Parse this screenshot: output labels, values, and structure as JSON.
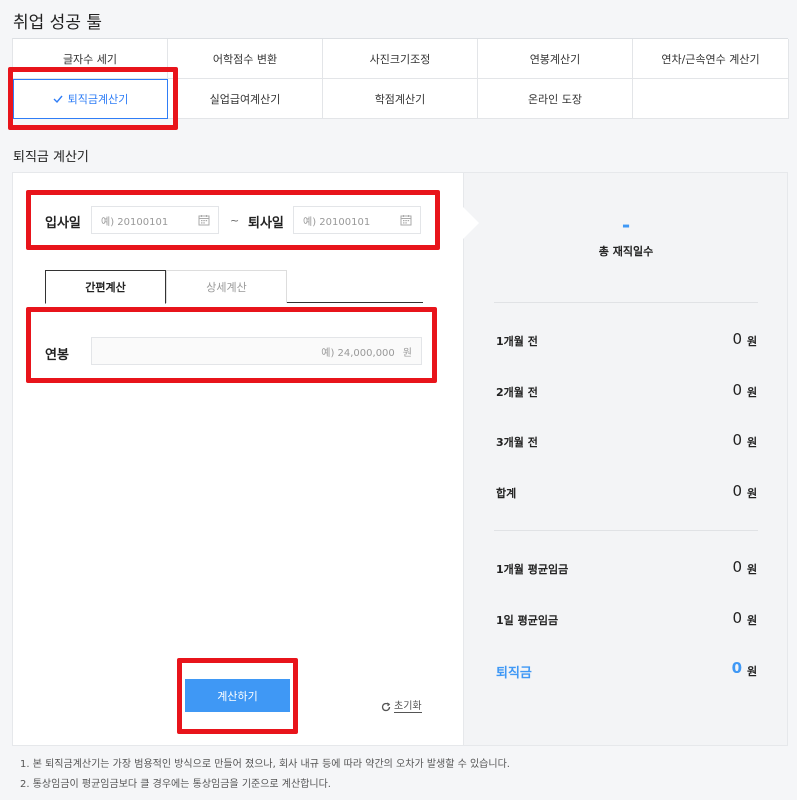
{
  "page_title": "취업 성공 툴",
  "tabs": [
    {
      "label": "글자수 세기"
    },
    {
      "label": "어학점수 변환"
    },
    {
      "label": "사진크기조정"
    },
    {
      "label": "연봉계산기"
    },
    {
      "label": "연차/근속연수 계산기"
    },
    {
      "label": "퇴직금계산기",
      "active": true
    },
    {
      "label": "실업급여계산기"
    },
    {
      "label": "학점계산기"
    },
    {
      "label": "온라인 도장"
    }
  ],
  "section_title": "퇴직금 계산기",
  "dates": {
    "start_label": "입사일",
    "start_placeholder": "예) 20100101",
    "separator": "~",
    "end_label": "퇴사일",
    "end_placeholder": "예) 20100101"
  },
  "subtabs": {
    "simple": "간편계산",
    "detail": "상세계산"
  },
  "salary": {
    "label": "연봉",
    "placeholder": "예) 24,000,000",
    "unit": "원"
  },
  "buttons": {
    "calculate": "계산하기",
    "reset": "초기화"
  },
  "result": {
    "days_value": "-",
    "days_label": "총 재직일수",
    "rows": [
      {
        "label": "1개월 전",
        "value": "0",
        "unit": "원"
      },
      {
        "label": "2개월 전",
        "value": "0",
        "unit": "원"
      },
      {
        "label": "3개월 전",
        "value": "0",
        "unit": "원"
      },
      {
        "label": "합계",
        "value": "0",
        "unit": "원"
      },
      {
        "label": "1개월 평균임금",
        "value": "0",
        "unit": "원"
      },
      {
        "label": "1일 평균임금",
        "value": "0",
        "unit": "원"
      },
      {
        "label": "퇴직금",
        "value": "0",
        "unit": "원"
      }
    ]
  },
  "notes": [
    "1. 본 퇴직금계산기는 가장 범용적인 방식으로 만들어 졌으나, 회사 내규 등에 따라 약간의 오차가 발생할 수 있습니다.",
    "2. 통상임금이 평균임금보다 클 경우에는 통상임금을 기준으로 계산합니다."
  ],
  "colors": {
    "accent": "#3f98f5",
    "active_tab": "#2f7df6",
    "annotation_box": "#e8141b"
  }
}
